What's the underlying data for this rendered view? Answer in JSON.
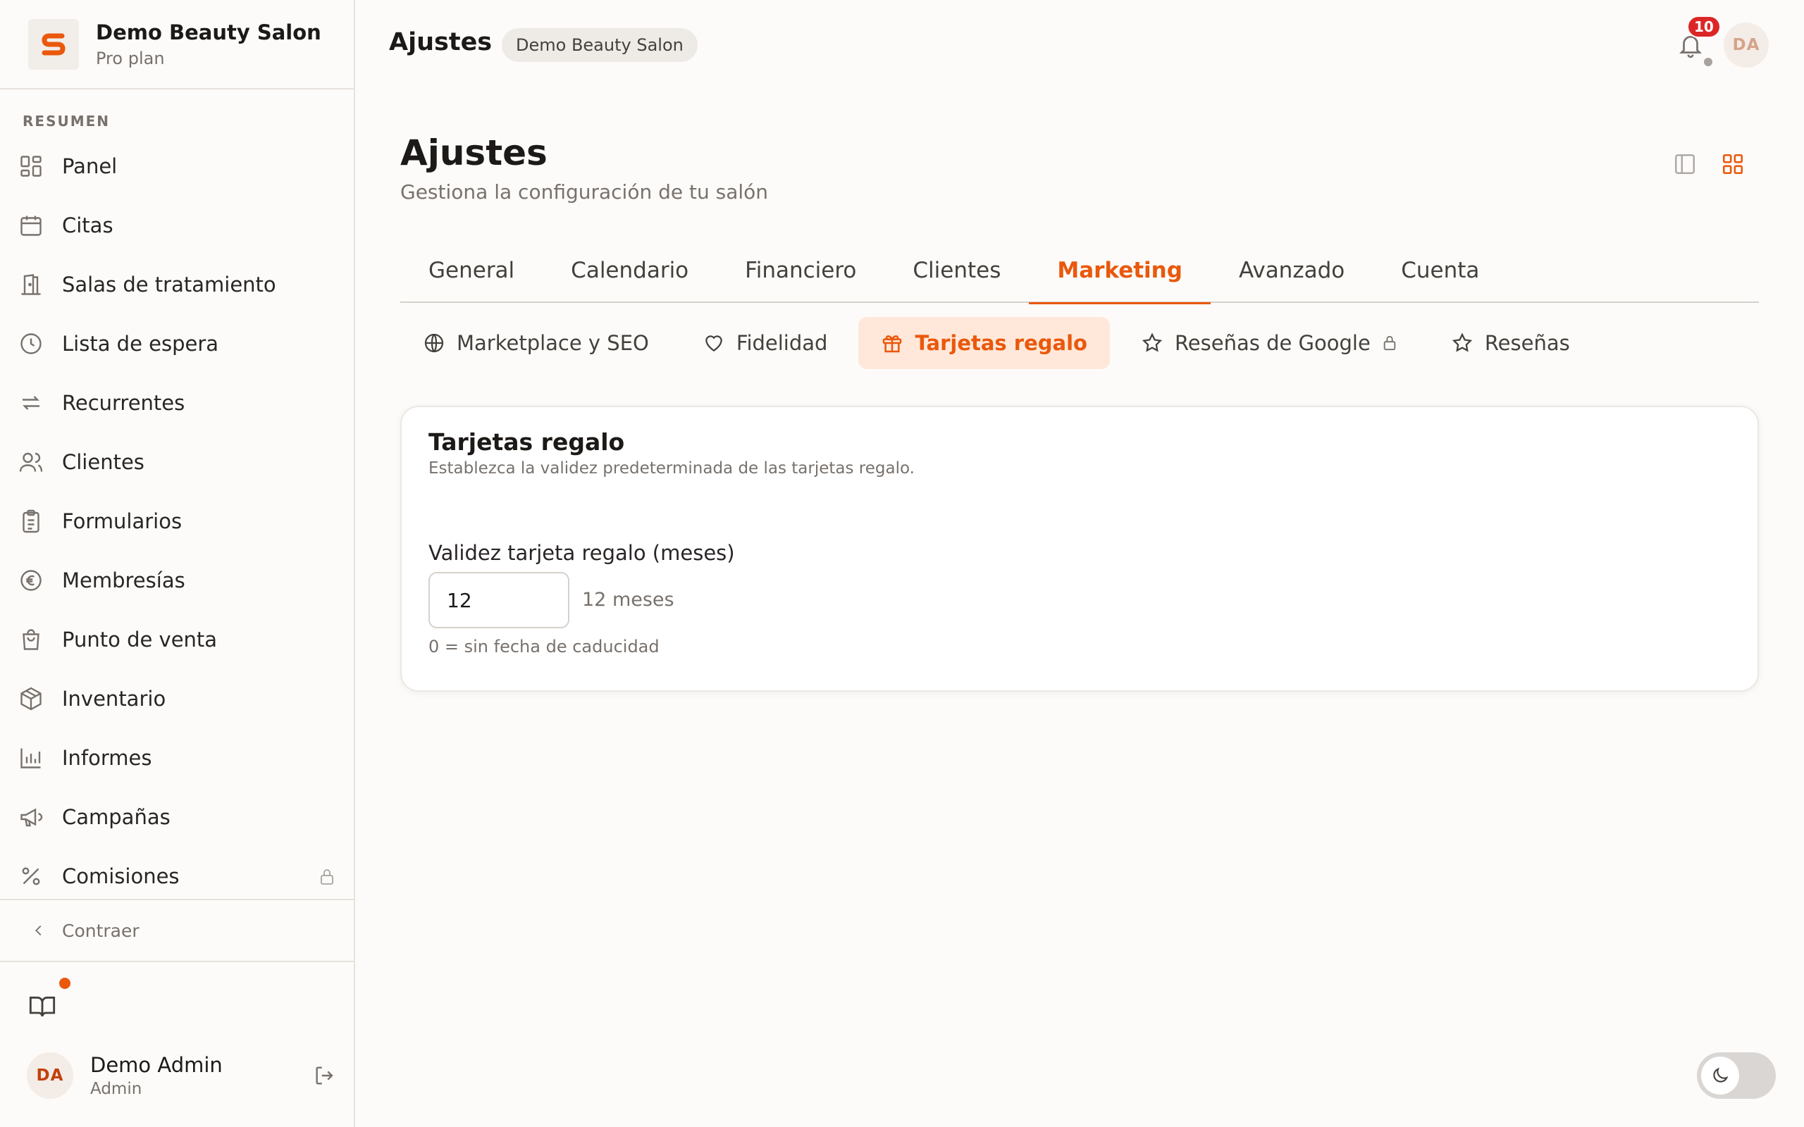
{
  "brand": {
    "name": "Demo Beauty Salon",
    "plan": "Pro plan",
    "logo_letter": "S",
    "accent_color": "#ea580c"
  },
  "sidebar": {
    "section_label": "RESUMEN",
    "items": [
      {
        "label": "Panel",
        "icon": "grid-icon"
      },
      {
        "label": "Citas",
        "icon": "calendar-icon"
      },
      {
        "label": "Salas de tratamiento",
        "icon": "door-icon"
      },
      {
        "label": "Lista de espera",
        "icon": "clock-icon"
      },
      {
        "label": "Recurrentes",
        "icon": "repeat-icon"
      },
      {
        "label": "Clientes",
        "icon": "users-icon"
      },
      {
        "label": "Formularios",
        "icon": "clipboard-icon"
      },
      {
        "label": "Membresías",
        "icon": "euro-icon"
      },
      {
        "label": "Punto de venta",
        "icon": "shopping-bag-icon"
      },
      {
        "label": "Inventario",
        "icon": "box-icon"
      },
      {
        "label": "Informes",
        "icon": "bar-chart-icon"
      },
      {
        "label": "Campañas",
        "icon": "megaphone-icon"
      },
      {
        "label": "Comisiones",
        "icon": "percent-icon",
        "locked": true
      }
    ],
    "collapse_label": "Contraer"
  },
  "user": {
    "initials": "DA",
    "name": "Demo Admin",
    "role": "Admin"
  },
  "topbar": {
    "title": "Ajustes",
    "salon": "Demo Beauty Salon",
    "notification_count": "10",
    "avatar_initials": "DA"
  },
  "page": {
    "title": "Ajustes",
    "subtitle": "Gestiona la configuración de tu salón"
  },
  "tabs": [
    {
      "label": "General"
    },
    {
      "label": "Calendario"
    },
    {
      "label": "Financiero"
    },
    {
      "label": "Clientes"
    },
    {
      "label": "Marketing",
      "active": true
    },
    {
      "label": "Avanzado"
    },
    {
      "label": "Cuenta"
    }
  ],
  "subtabs": [
    {
      "label": "Marketplace y SEO",
      "icon": "globe-icon"
    },
    {
      "label": "Fidelidad",
      "icon": "heart-icon"
    },
    {
      "label": "Tarjetas regalo",
      "icon": "gift-icon",
      "active": true
    },
    {
      "label": "Reseñas de Google",
      "icon": "star-icon",
      "locked": true
    },
    {
      "label": "Reseñas",
      "icon": "star-icon"
    }
  ],
  "card": {
    "title": "Tarjetas regalo",
    "description": "Establezca la validez predeterminada de las tarjetas regalo.",
    "field_label": "Validez tarjeta regalo (meses)",
    "field_value": "12",
    "field_suffix": "12 meses",
    "field_help": "0 = sin fecha de caducidad"
  }
}
